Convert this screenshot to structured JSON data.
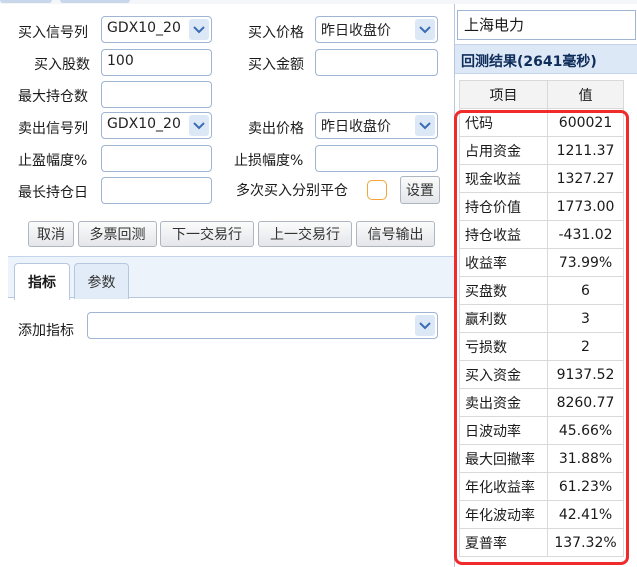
{
  "form": {
    "buy_signal_label": "买入信号列",
    "buy_signal_value": "GDX10_20",
    "buy_price_label": "买入价格",
    "buy_price_value": "昨日收盘价",
    "buy_shares_label": "买入股数",
    "buy_shares_value": "100",
    "buy_amount_label": "买入金额",
    "buy_amount_value": "",
    "max_hold_label": "最大持仓数",
    "max_hold_value": "",
    "sell_signal_label": "卖出信号列",
    "sell_signal_value": "GDX10_20",
    "sell_price_label": "卖出价格",
    "sell_price_value": "昨日收盘价",
    "take_profit_label": "止盈幅度%",
    "take_profit_value": "",
    "stop_loss_label": "止损幅度%",
    "stop_loss_value": "",
    "max_days_label": "最长持仓日",
    "max_days_value": "",
    "multi_buy_label": "多次买入分别平仓",
    "settings_button": "设置"
  },
  "actions": {
    "cancel": "取消",
    "multi_backtest": "多票回测",
    "next_day": "下一交易行",
    "prev_day": "上一交易行",
    "signal_output": "信号输出"
  },
  "tabs": [
    {
      "label": "指标",
      "active": true
    },
    {
      "label": "参数",
      "active": false
    }
  ],
  "indicator_panel": {
    "add_label": "添加指标",
    "add_value": ""
  },
  "results": {
    "stock_name": "上海电力",
    "header": "回测结果(2641毫秒)",
    "col_item": "项目",
    "col_value": "值",
    "rows": [
      {
        "item": "代码",
        "value": "600021"
      },
      {
        "item": "占用资金",
        "value": "1211.37"
      },
      {
        "item": "现金收益",
        "value": "1327.27"
      },
      {
        "item": "持仓价值",
        "value": "1773.00"
      },
      {
        "item": "持仓收益",
        "value": "-431.02"
      },
      {
        "item": "收益率",
        "value": "73.99%"
      },
      {
        "item": "买盘数",
        "value": "6"
      },
      {
        "item": "赢利数",
        "value": "3"
      },
      {
        "item": "亏损数",
        "value": "2"
      },
      {
        "item": "买入资金",
        "value": "9137.52"
      },
      {
        "item": "卖出资金",
        "value": "8260.77"
      },
      {
        "item": "日波动率",
        "value": "45.66%"
      },
      {
        "item": "最大回撤率",
        "value": "31.88%"
      },
      {
        "item": "年化收益率",
        "value": "61.23%"
      },
      {
        "item": "年化波动率",
        "value": "42.41%"
      },
      {
        "item": "夏普率",
        "value": "137.32%"
      }
    ]
  },
  "colors": {
    "accent_blue": "#9fb5d3",
    "header_bg": "#dde8f6",
    "highlight_red": "#ef2b2b",
    "checkbox_orange": "#f2a53a"
  }
}
